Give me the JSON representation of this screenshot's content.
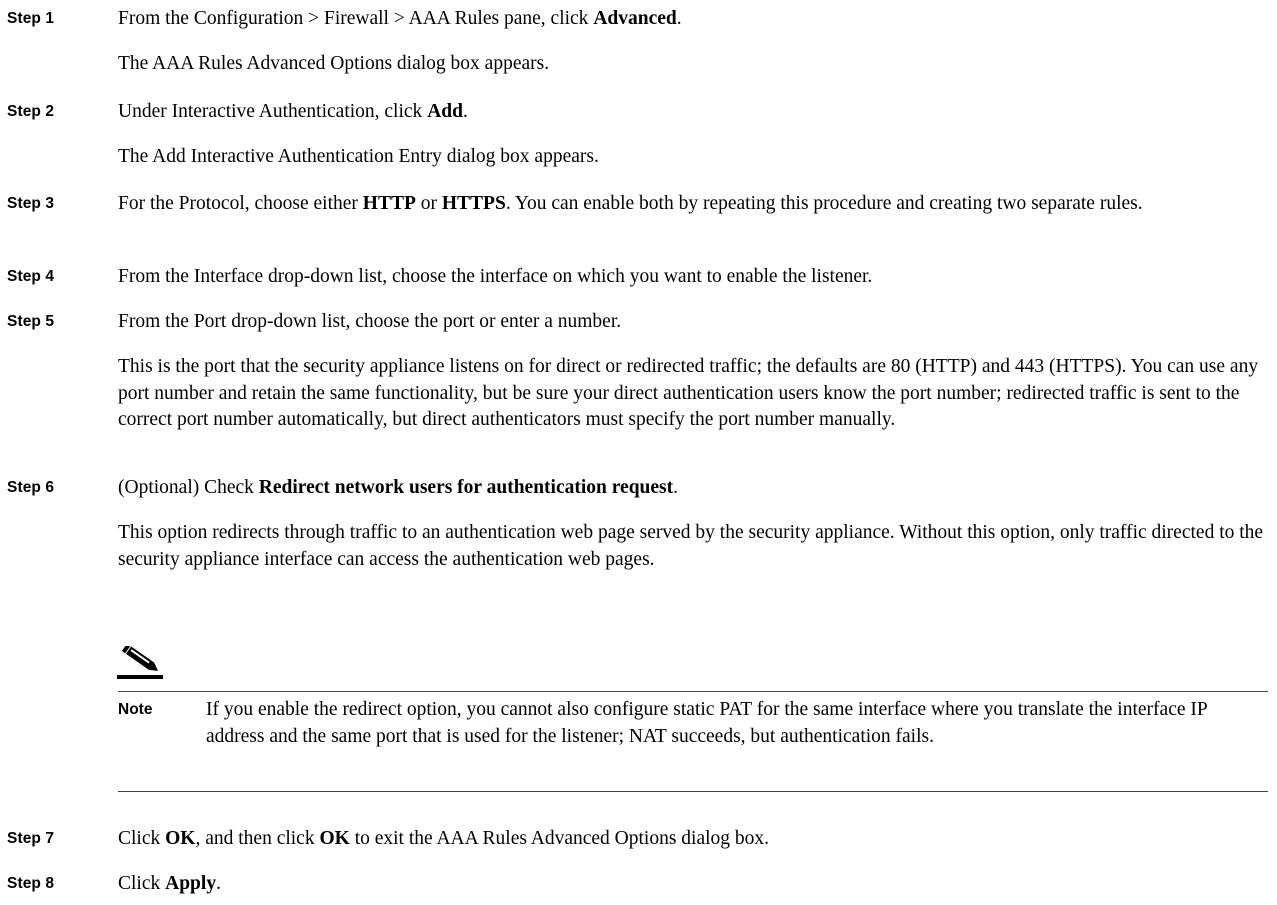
{
  "steps": [
    {
      "label": "Step 1",
      "p1_before": "From the Configuration > Firewall > AAA Rules pane, click ",
      "p1_bold": "Advanced",
      "p1_after": ".",
      "p2": "The AAA Rules Advanced Options dialog box appears."
    },
    {
      "label": "Step 2",
      "p1_before": "Under Interactive Authentication, click ",
      "p1_bold": "Add",
      "p1_after": ".",
      "p2": "The Add Interactive Authentication Entry dialog box appears."
    },
    {
      "label": "Step 3",
      "p1_before": "For the Protocol, choose either ",
      "p1_bold": "HTTP",
      "p1_mid": " or ",
      "p1_bold2": "HTTPS",
      "p1_after": ". You can enable both by repeating this procedure and creating two separate rules."
    },
    {
      "label": "Step 4",
      "p1": "From the Interface drop-down list, choose the interface on which you want to enable the listener."
    },
    {
      "label": "Step 5",
      "p1": "From the Port drop-down list, choose the port or enter a number.",
      "p2": "This is the port that the security appliance listens on for direct or redirected traffic; the defaults are 80 (HTTP) and 443 (HTTPS). You can use any port number and retain the same functionality, but be sure your direct authentication users know the port number; redirected traffic is sent to the correct port number automatically, but direct authenticators must specify the port number manually."
    },
    {
      "label": "Step 6",
      "p1_before": "(Optional) Check ",
      "p1_bold": "Redirect network users for authentication request",
      "p1_after": ".",
      "p2": "This option redirects through traffic to an authentication web page served by the security appliance. Without this option, only traffic directed to the security appliance interface can access the authentication web pages."
    },
    {
      "label": "Step 7",
      "p1_before": "Click ",
      "p1_bold": "OK",
      "p1_mid": ", and then click ",
      "p1_bold2": "OK",
      "p1_after": " to exit the AAA Rules Advanced Options dialog box."
    },
    {
      "label": "Step 8",
      "p1_before": "Click ",
      "p1_bold": "Apply",
      "p1_after": "."
    }
  ],
  "note": {
    "label": "Note",
    "text": "If you enable the redirect option, you cannot also configure static PAT for the same interface where you translate the interface IP address and the same port that is used for the listener; NAT succeeds, but authentication fails.",
    "icon": "pencil-icon"
  }
}
